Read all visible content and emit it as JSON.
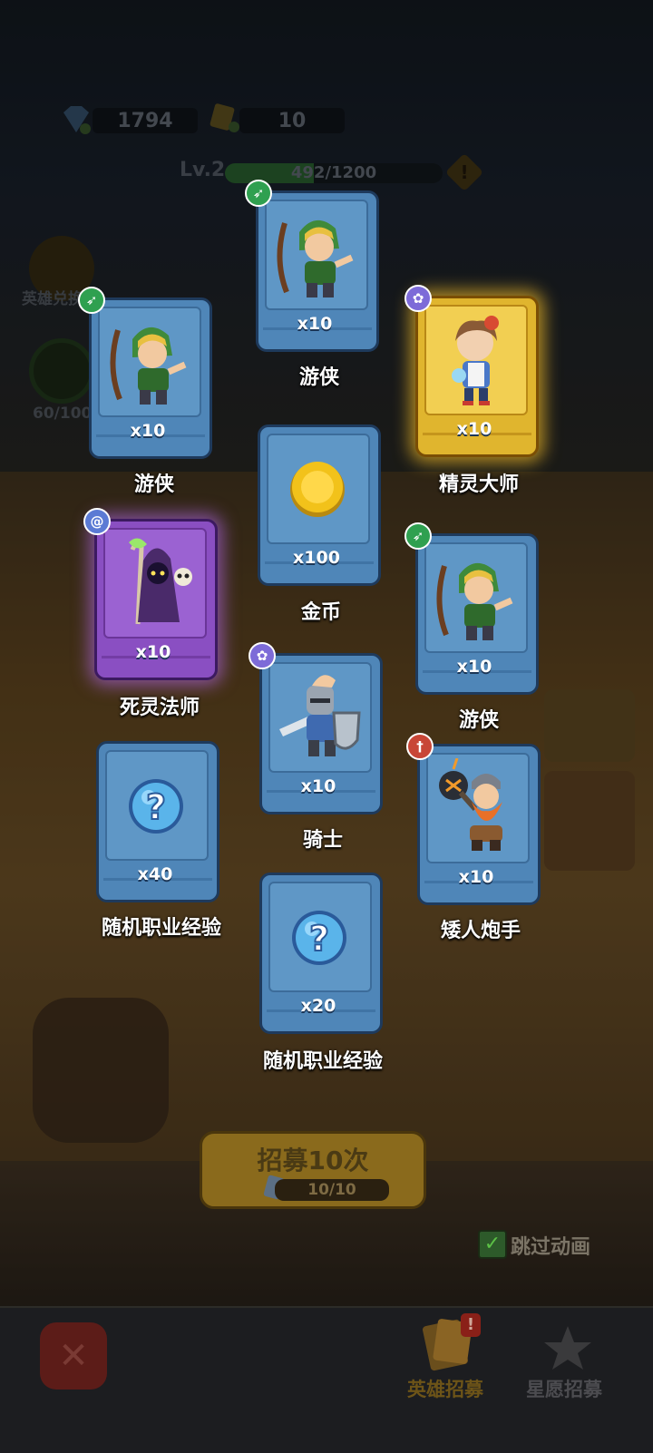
{
  "hud": {
    "gems": "1794",
    "tickets": "10",
    "level_label": "Lv.2",
    "xp_text": "492/1200",
    "xp_fraction": 0.41,
    "warning": "!"
  },
  "side": {
    "hero_exchange_label": "英雄兑换",
    "star_progress": "60/100"
  },
  "cards": [
    {
      "name": "游侠",
      "qty": "x10",
      "rarity": "blue",
      "class_icon": "bow-icon",
      "art": "ranger"
    },
    {
      "name": "游侠",
      "qty": "x10",
      "rarity": "blue",
      "class_icon": "bow-icon",
      "art": "ranger"
    },
    {
      "name": "精灵大师",
      "qty": "x10",
      "rarity": "gold",
      "class_icon": "paw-icon",
      "art": "elf-master"
    },
    {
      "name": "金币",
      "qty": "x100",
      "rarity": "blue",
      "class_icon": "",
      "art": "coin"
    },
    {
      "name": "死灵法师",
      "qty": "x10",
      "rarity": "purple",
      "class_icon": "spiral-icon",
      "art": "necromancer"
    },
    {
      "name": "游侠",
      "qty": "x10",
      "rarity": "blue",
      "class_icon": "bow-icon",
      "art": "ranger"
    },
    {
      "name": "骑士",
      "qty": "x10",
      "rarity": "blue",
      "class_icon": "paw-icon",
      "art": "knight"
    },
    {
      "name": "随机职业经验",
      "qty": "x40",
      "rarity": "blue",
      "class_icon": "",
      "art": "question"
    },
    {
      "name": "矮人炮手",
      "qty": "x10",
      "rarity": "blue",
      "class_icon": "dagger-icon",
      "art": "dwarf"
    },
    {
      "name": "随机职业经验",
      "qty": "x20",
      "rarity": "blue",
      "class_icon": "",
      "art": "question"
    }
  ],
  "recruit": {
    "label": "招募10次",
    "count": "10/10"
  },
  "skip": {
    "label": "跳过动画",
    "checked": true
  },
  "tabs": {
    "hero_recruit": "英雄招募",
    "wish_recruit": "星愿招募",
    "hero_recruit_badge": "!"
  },
  "colors": {
    "card_blue": "#4f86b8",
    "card_gold": "#e0b52e",
    "card_purple": "#8a4fc2",
    "class_green": "#2fa050"
  }
}
